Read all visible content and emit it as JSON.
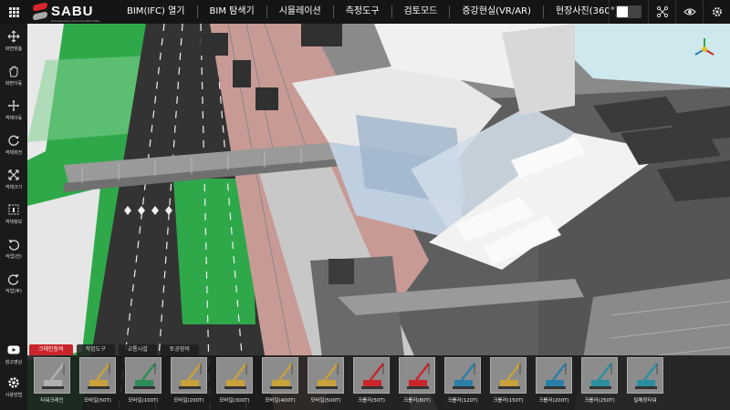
{
  "brand": {
    "name": "SABU",
    "tagline": "Distinguishing Advanced BIM Utility"
  },
  "menu": [
    {
      "label": "BIM(IFC) 열기"
    },
    {
      "label": "BIM 탐색기"
    },
    {
      "label": "시뮬레이션"
    },
    {
      "label": "측정도구"
    },
    {
      "label": "검토모드"
    },
    {
      "label": "증강현실(VR/AR)"
    },
    {
      "label": "현장사진(360°)"
    }
  ],
  "top_right": {
    "toggle_state": "on",
    "icons": [
      "share-icon",
      "eye-icon",
      "gear-icon"
    ]
  },
  "toolbar": [
    {
      "label": "화면맞춤",
      "icon": "fit-screen-icon"
    },
    {
      "label": "화면이동",
      "icon": "hand-icon"
    },
    {
      "label": "객체이동",
      "icon": "move-icon"
    },
    {
      "label": "객체회전",
      "icon": "rotate-icon"
    },
    {
      "label": "객체크기",
      "icon": "scale-icon"
    },
    {
      "label": "객체정보",
      "icon": "info-icon"
    },
    {
      "label": "작업(전)",
      "icon": "undo-icon"
    },
    {
      "label": "작업(후)",
      "icon": "redo-icon"
    }
  ],
  "toolbar_bottom": [
    {
      "label": "참고영상",
      "icon": "youtube-icon"
    },
    {
      "label": "사용방법",
      "icon": "gear-icon"
    }
  ],
  "tabs": [
    {
      "label": "크레인장비",
      "active": true
    },
    {
      "label": "작업도구",
      "active": false
    },
    {
      "label": "교통시설",
      "active": false
    },
    {
      "label": "토공장비",
      "active": false
    }
  ],
  "equipment": [
    {
      "label": "타워크레인",
      "color": "#b0b0b0"
    },
    {
      "label": "모바일(50T)",
      "color": "#c8a13a"
    },
    {
      "label": "모바일(100T)",
      "color": "#2e8b57"
    },
    {
      "label": "모바일(200T)",
      "color": "#c8a13a"
    },
    {
      "label": "모바일(300T)",
      "color": "#c8a13a"
    },
    {
      "label": "모바일(400T)",
      "color": "#c8a13a"
    },
    {
      "label": "모바일(500T)",
      "color": "#c8a13a"
    },
    {
      "label": "크롤러(50T)",
      "color": "#c9262c"
    },
    {
      "label": "크롤러(80T)",
      "color": "#c9262c"
    },
    {
      "label": "크롤러(120T)",
      "color": "#2a7fa8"
    },
    {
      "label": "크롤러(150T)",
      "color": "#c8a13a"
    },
    {
      "label": "크롤러(200T)",
      "color": "#2a7fa8"
    },
    {
      "label": "크롤러(250T)",
      "color": "#2a8fa0"
    },
    {
      "label": "밀폐창타워",
      "color": "#2a8fa0"
    }
  ],
  "colors": {
    "accent": "#c9262c",
    "grass": "#2fa84a",
    "road": "#3a3a3a"
  }
}
